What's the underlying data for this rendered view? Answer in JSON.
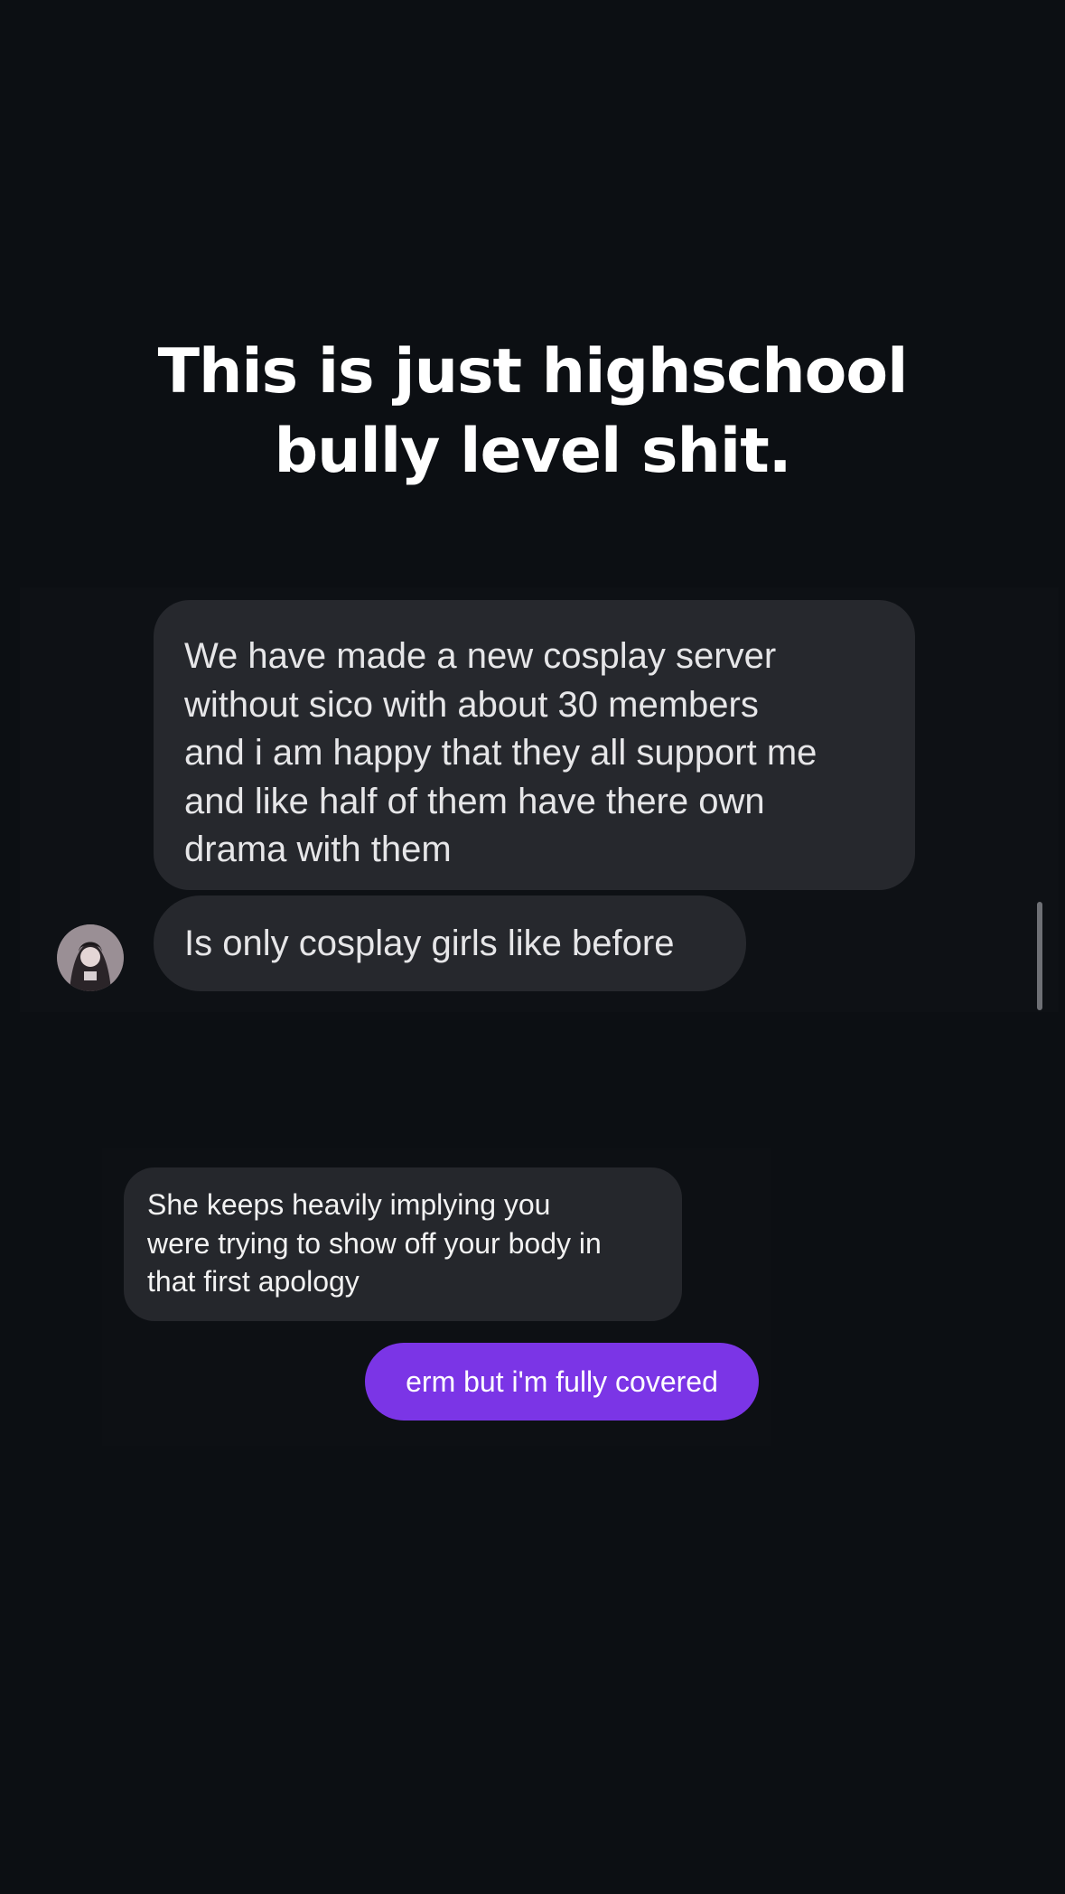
{
  "caption": {
    "line1": "This is just highschool",
    "line2": "bully level shit."
  },
  "screenshot1": {
    "message1": {
      "lines": [
        "We have made a new cosplay server",
        "without sico with about 30 members",
        "and i am happy that they all support me",
        "and like half of them have there own",
        "drama with them"
      ]
    },
    "message2": "Is only cosplay girls like before"
  },
  "screenshot2": {
    "received": {
      "lines": [
        "She keeps heavily implying you",
        "were trying to show off your body in",
        "that first apology"
      ]
    },
    "sent": "erm but i'm fully covered",
    "colors": {
      "sent_bubble": "#7b35e6",
      "received_bubble": "#25272c"
    }
  }
}
